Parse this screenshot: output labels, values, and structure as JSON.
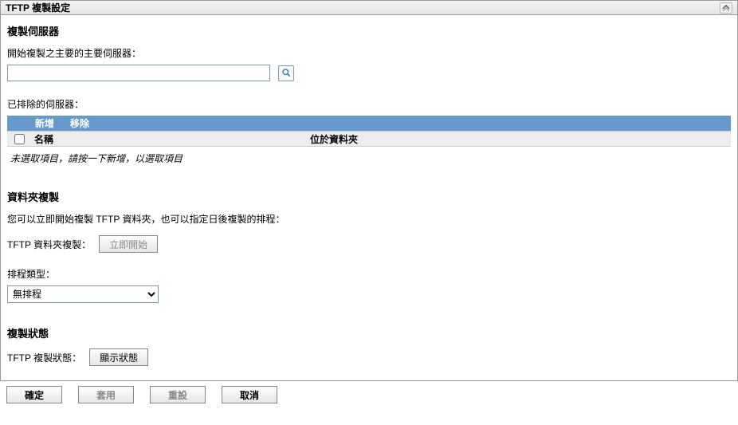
{
  "panel": {
    "title": "TFTP 複製設定"
  },
  "section_server": {
    "title": "複製伺服器",
    "primary_label": "開始複製之主要的主要伺服器：",
    "primary_value": "",
    "excluded_label": "已排除的伺服器："
  },
  "actions": {
    "add": "新增",
    "remove": "移除"
  },
  "table": {
    "col_name": "名稱",
    "col_folder": "位於資料夾",
    "empty": "未選取項目，請按一下新增，以選取項目"
  },
  "section_folder": {
    "title": "資料夾複製",
    "desc": "您可以立即開始複製 TFTP 資料夾，也可以指定日後複製的排程：",
    "replicate_label": "TFTP 資料夾複製：",
    "start_now": "立即開始",
    "schedule_type_label": "排程類型：",
    "schedule_selected": "無排程"
  },
  "section_status": {
    "title": "複製狀態",
    "label": "TFTP 複製狀態：",
    "show_status": "顯示狀態"
  },
  "buttons": {
    "ok": "確定",
    "apply": "套用",
    "reset": "重設",
    "cancel": "取消"
  }
}
